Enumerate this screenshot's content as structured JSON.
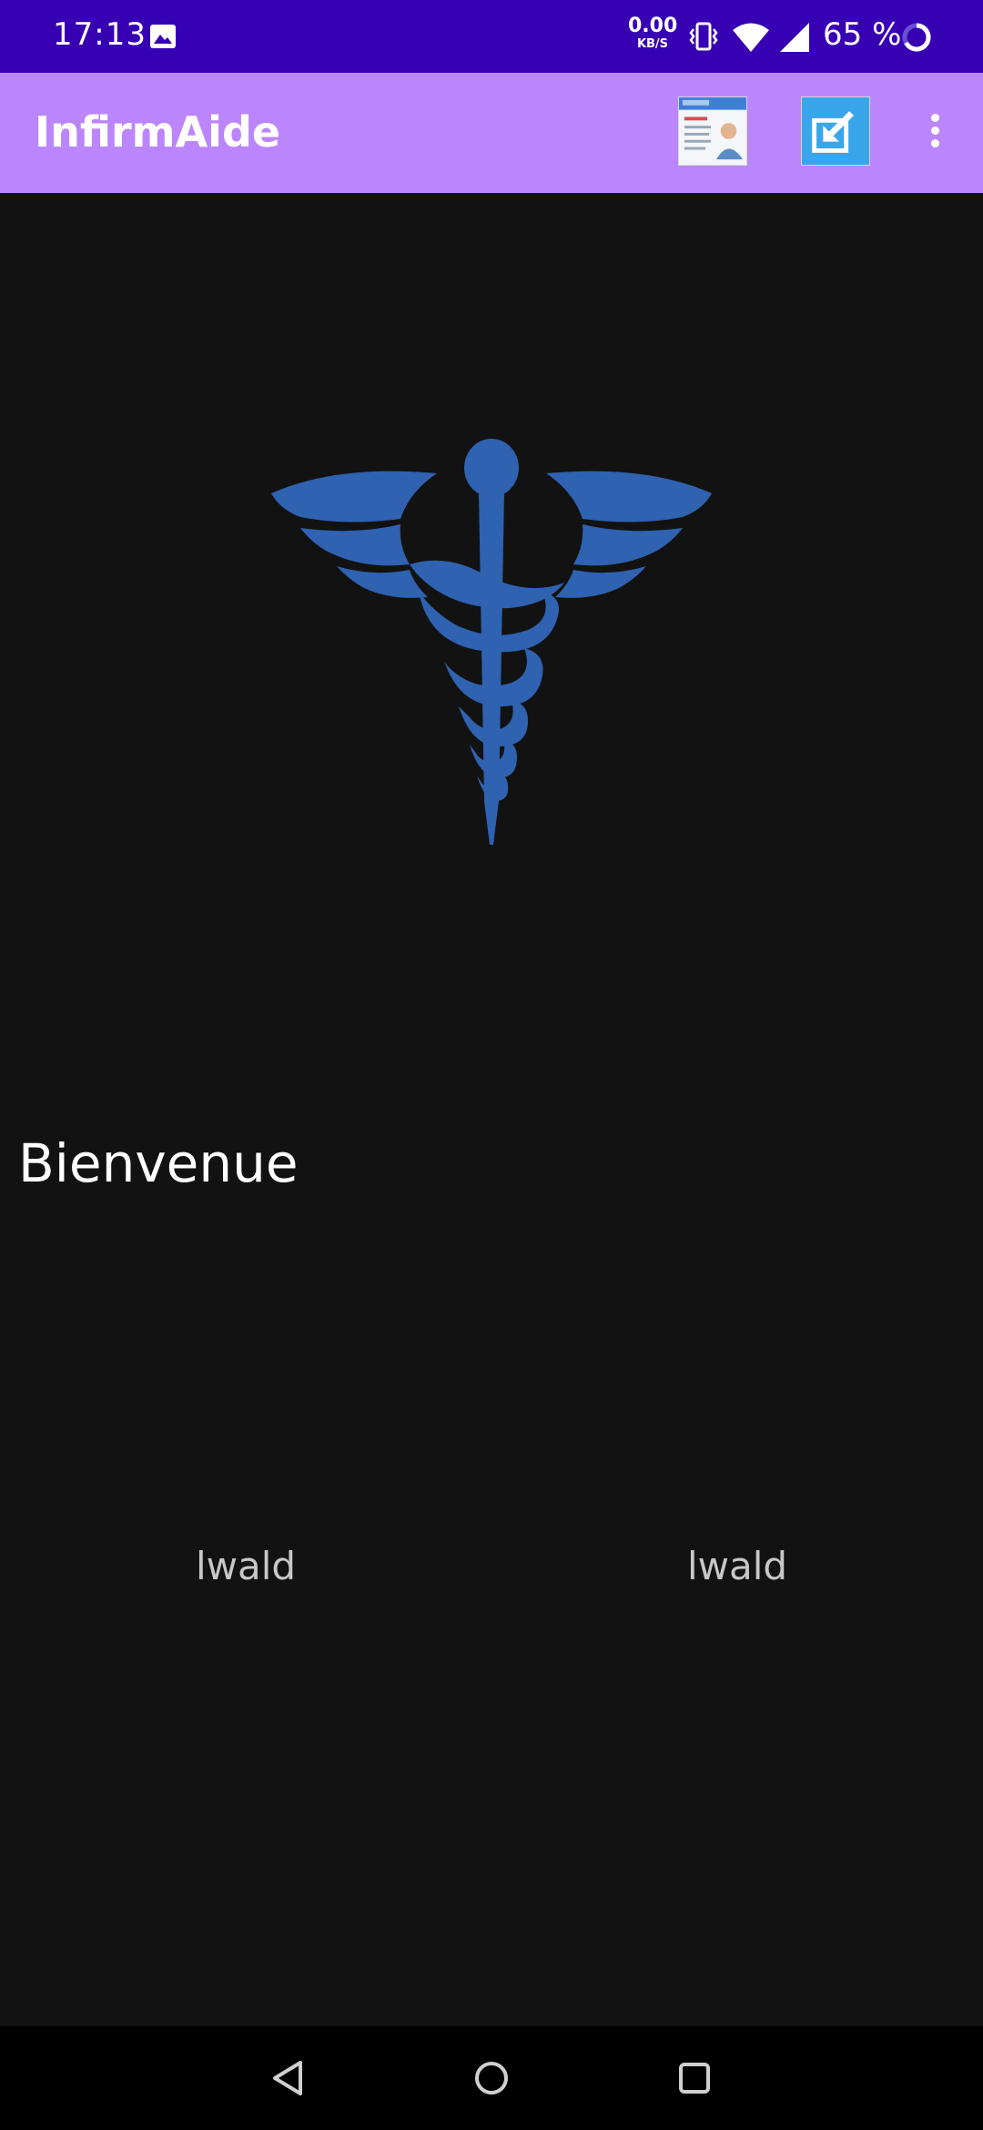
{
  "status_bar": {
    "time": "17:13",
    "net_speed_value": "0.00",
    "net_speed_unit": "KB/S",
    "battery": "65 %",
    "icons": [
      "image-icon",
      "vibrate-icon",
      "wifi-icon",
      "signal-icon",
      "battery-ring-icon"
    ]
  },
  "app_bar": {
    "title": "InfirmAide",
    "actions": [
      "profile-card-icon",
      "export-icon",
      "overflow-menu-icon"
    ]
  },
  "main": {
    "logo_icon": "caduceus-icon",
    "welcome": "Bienvenue",
    "name_left": "lwald",
    "name_right": "lwald"
  },
  "nav_bar": {
    "buttons": [
      "back-icon",
      "home-icon",
      "recents-icon"
    ]
  },
  "colors": {
    "status_bar": "#3700b3",
    "app_bar": "#bb86fc",
    "background": "#121212",
    "logo": "#2f62b0"
  }
}
